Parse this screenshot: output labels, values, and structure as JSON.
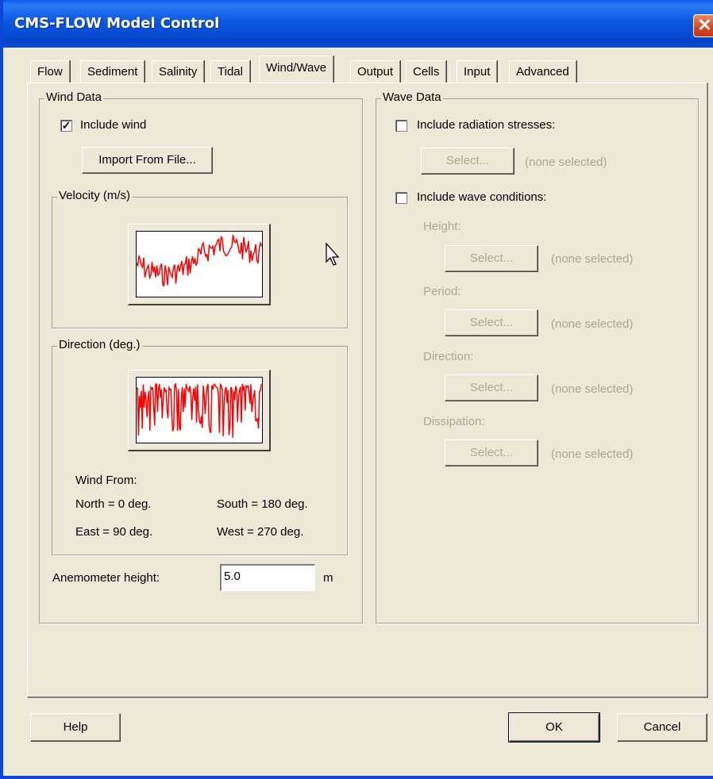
{
  "window": {
    "title": "CMS-FLOW Model Control",
    "close_glyph": "✕"
  },
  "tabs": [
    "Flow",
    "Sediment",
    "Salinity",
    "Tidal",
    "Wind/Wave",
    "Output",
    "Cells",
    "Input",
    "Advanced"
  ],
  "active_tab": "Wind/Wave",
  "wind": {
    "group_label": "Wind Data",
    "include_wind_label": "Include wind",
    "include_wind_checked": true,
    "import_button": "Import From File...",
    "velocity_label": "Velocity (m/s)",
    "direction_label": "Direction (deg.)",
    "wind_from_label": "Wind From:",
    "north": "North = 0 deg.",
    "south": "South = 180 deg.",
    "east": "East = 90 deg.",
    "west": "West = 270 deg.",
    "anemometer_label": "Anemometer height:",
    "anemometer_value": "5.0",
    "anemometer_unit": "m"
  },
  "wave": {
    "group_label": "Wave Data",
    "radiation_label": "Include radiation stresses:",
    "radiation_checked": false,
    "radiation_select": "Select...",
    "radiation_none": "(none selected)",
    "conditions_label": "Include wave conditions:",
    "conditions_checked": false,
    "height_label": "Height:",
    "height_select": "Select...",
    "height_none": "(none selected)",
    "period_label": "Period:",
    "period_select": "Select...",
    "period_none": "(none selected)",
    "direction_label": "Direction:",
    "direction_select": "Select...",
    "direction_none": "(none selected)",
    "dissipation_label": "Dissipation:",
    "dissipation_select": "Select...",
    "dissipation_none": "(none selected)"
  },
  "footer": {
    "help": "Help",
    "ok": "OK",
    "cancel": "Cancel"
  },
  "colors": {
    "titlebar": "#0b58e0",
    "dialog_bg": "#ece9d8",
    "plot_line": "#ff0000",
    "close_button": "#d0451f"
  },
  "icons": {
    "close": "close-icon",
    "cursor": "mouse-pointer-icon"
  }
}
